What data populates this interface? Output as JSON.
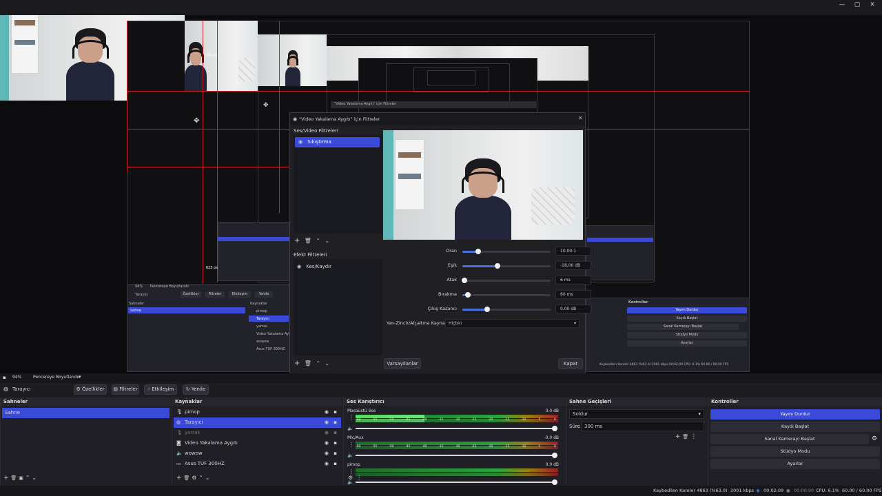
{
  "preview": {
    "px_label_1": "220 px",
    "px_label_2": "625 px",
    "nested_dialog_title": "\"Video Yakalama Aygıtı\" için Filtreler",
    "nested_scene": "Tarayıcı",
    "nested_sahneler": "Sahneler",
    "nested_sahne": "Sahne",
    "nested_kaynaklar": "Kaynaklar",
    "nested_sources": [
      "pimop",
      "Tarayıcı",
      "yarrak",
      "Video Yakalama Aygıtı",
      "wowow",
      "Asus TUF 300HZ"
    ],
    "nested_btn_ozellikler": "Özellikler",
    "nested_btn_filtreler": "Filtreler",
    "nested_btn_etkilesim": "Etkileşim",
    "nested_btn_yenile": "Yenile",
    "nested_kontroller": "Kontroller",
    "nested_controls": [
      "Yayını Durdur",
      "Kaydı Başlat",
      "Sanal Kamerayı Başlat",
      "Stüdyo Modu",
      "Ayarlar"
    ],
    "nested_status": "Kaybedilen Kareler 4863 (%63.0)   2001 kbps   00:02:09   CPU: 6.1%   60.00 / 60.00 FPS"
  },
  "dialog": {
    "title": "\"Video Yakalama Aygıtı\" için Filtreler",
    "av_filters_header": "Ses/Video Filtreleri",
    "av_filters": [
      "Sıkıştırma"
    ],
    "effect_filters_header": "Efekt Filtreleri",
    "effect_filters": [
      "Kes/Kaydır"
    ],
    "params": [
      {
        "label": "Oran",
        "value": "10,00:1",
        "level": 0.18
      },
      {
        "label": "Eşik",
        "value": "-18,00 dB",
        "level": 0.4
      },
      {
        "label": "Atak",
        "value": "6 ms",
        "level": 0.02
      },
      {
        "label": "Bırakma",
        "value": "60 ms",
        "level": 0.06
      },
      {
        "label": "Çıkış Kazancı",
        "value": "0,00 dB",
        "level": 0.28
      }
    ],
    "sidechain_label": "Yan-Zincir/Alçaltma Kaynağı",
    "sidechain_value": "Hiçbiri",
    "defaults_button": "Varsayılanlar",
    "close_button": "Kapat"
  },
  "strip": {
    "zoom": "94%",
    "fit_label": "Pencereye Boyutlandır"
  },
  "toolbar": {
    "source_name": "Tarayıcı",
    "ozellikler": "Özellikler",
    "filtreler": "Filtreler",
    "etkilesim": "Etkileşim",
    "yenile": "Yenile"
  },
  "scenes": {
    "header": "Sahneler",
    "items": [
      "Sahne"
    ]
  },
  "sources": {
    "header": "Kaynaklar",
    "items": [
      {
        "name": "pimop",
        "icon": "mic-icon"
      },
      {
        "name": "Tarayıcı",
        "icon": "globe-icon"
      },
      {
        "name": "yarrak",
        "icon": "mic-icon"
      },
      {
        "name": "Video Yakalama Aygıtı",
        "icon": "camera-icon"
      },
      {
        "name": "wowow",
        "icon": "speaker-icon"
      },
      {
        "name": "Asus TUF 300HZ",
        "icon": "monitor-icon"
      }
    ]
  },
  "mixer": {
    "header": "Ses Karıştırıcı",
    "scale": [
      "-60",
      "-55",
      "-50",
      "-45",
      "-40",
      "-35",
      "-30",
      "-25",
      "-20",
      "-15",
      "-10",
      "-5",
      "0"
    ],
    "channels": [
      {
        "name": "Masaüstü Ses",
        "db": "0.0 dB",
        "level": 0.34
      },
      {
        "name": "Mic/Aux",
        "db": "-0.0 dB",
        "level": 0
      },
      {
        "name": "pimop",
        "db": "0.0 dB",
        "level": 0
      }
    ]
  },
  "transitions": {
    "header": "Sahne Geçişleri",
    "type": "Soldur",
    "duration_label": "Süre",
    "duration_value": "300 ms"
  },
  "controls": {
    "header": "Kontroller",
    "buttons": [
      "Yayını Durdur",
      "Kaydı Başlat",
      "Sanal Kamerayı Başlat",
      "Stüdyo Modu",
      "Ayarlar"
    ]
  },
  "status": {
    "dropped": "Kaybedilen Kareler 4863 (%63.0)",
    "bitrate": "2001 kbps",
    "stream_time": "00:02:09",
    "rec_time": "00:00:00",
    "cpu": "CPU: 6.1%",
    "fps": "60.00 / 60.00 FPS"
  },
  "colors": {
    "accent": "#3b4bd9",
    "redline": "#c81f2a"
  }
}
